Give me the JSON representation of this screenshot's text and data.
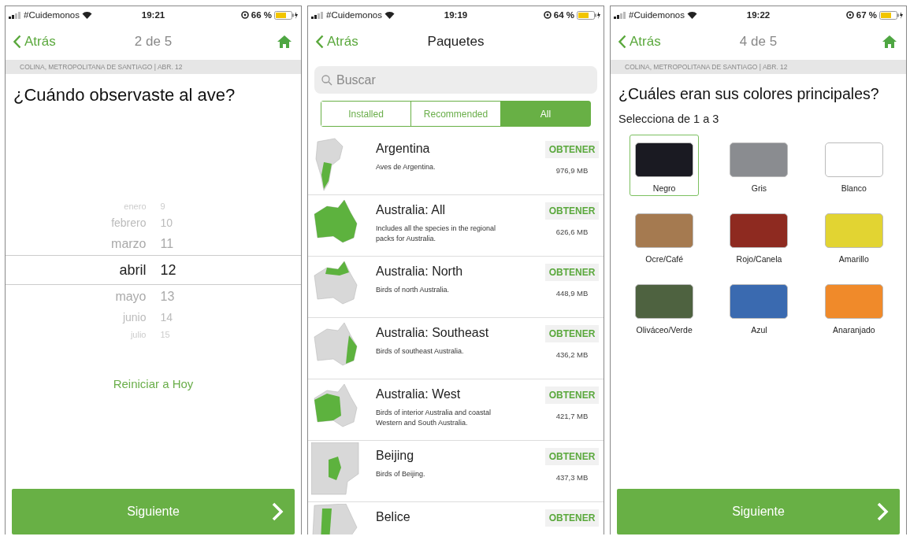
{
  "screens": [
    {
      "kind": "date",
      "status_bar": {
        "carrier": "#Cuidemonos",
        "time": "19:21",
        "battery": "66 %"
      },
      "nav": {
        "back": "Atrás",
        "title": "2 de 5"
      },
      "location": "COLINA, METROPOLITANA DE SANTIAGO | ABR. 12",
      "title": "¿Cuándo observaste al ave?",
      "picker": [
        {
          "month": "enero",
          "day": "9",
          "selected": false
        },
        {
          "month": "febrero",
          "day": "10",
          "selected": false
        },
        {
          "month": "marzo",
          "day": "11",
          "selected": false
        },
        {
          "month": "abril",
          "day": "12",
          "selected": true
        },
        {
          "month": "mayo",
          "day": "13",
          "selected": false
        },
        {
          "month": "junio",
          "day": "14",
          "selected": false
        },
        {
          "month": "julio",
          "day": "15",
          "selected": false
        }
      ],
      "reset_link": "Reiniciar a Hoy",
      "next_button": "Siguiente"
    },
    {
      "kind": "packages",
      "status_bar": {
        "carrier": "#Cuidemonos",
        "time": "19:19",
        "battery": "64 %"
      },
      "nav": {
        "back": "Atrás",
        "title": "Paquetes"
      },
      "search": {
        "placeholder": "Buscar"
      },
      "tabs": [
        {
          "label": "Installed",
          "selected": false
        },
        {
          "label": "Recommended",
          "selected": false
        },
        {
          "label": "All",
          "selected": true
        }
      ],
      "packages": [
        {
          "name": "Argentina",
          "description": "Aves de Argentina.",
          "action": "OBTENER",
          "size": "976,9 MB"
        },
        {
          "name": "Australia: All",
          "description": "Includes all the species in the regional packs for Australia.",
          "action": "OBTENER",
          "size": "626,6 MB"
        },
        {
          "name": "Australia: North",
          "description": "Birds of north Australia.",
          "action": "OBTENER",
          "size": "448,9 MB"
        },
        {
          "name": "Australia: Southeast",
          "description": "Birds of southeast Australia.",
          "action": "OBTENER",
          "size": "436,2 MB"
        },
        {
          "name": "Australia: West",
          "description": "Birds of interior Australia and coastal Western and South Australia.",
          "action": "OBTENER",
          "size": "421,7 MB"
        },
        {
          "name": "Beijing",
          "description": "Birds of Beijing.",
          "action": "OBTENER",
          "size": "437,3 MB"
        },
        {
          "name": "Belice",
          "action": "OBTENER"
        }
      ]
    },
    {
      "kind": "colors",
      "status_bar": {
        "carrier": "#Cuidemonos",
        "time": "19:22",
        "battery": "67 %"
      },
      "nav": {
        "back": "Atrás",
        "title": "4 de 5"
      },
      "location": "COLINA, METROPOLITANA DE SANTIAGO | ABR. 12",
      "title": "¿Cuáles eran sus colores principales?",
      "subtitle": "Selecciona de 1 a 3",
      "colors": [
        {
          "label": "Negro",
          "color": "#1a1a22",
          "selected": true
        },
        {
          "label": "Gris",
          "color": "#8a8c90",
          "selected": false
        },
        {
          "label": "Blanco",
          "color": "#ffffff",
          "selected": false
        },
        {
          "label": "Ocre/Café",
          "color": "#a57a50",
          "selected": false
        },
        {
          "label": "Rojo/Canela",
          "color": "#8e2a20",
          "selected": false
        },
        {
          "label": "Amarillo",
          "color": "#e2d432",
          "selected": false
        },
        {
          "label": "Oliváceo/Verde",
          "color": "#4e6240",
          "selected": false
        },
        {
          "label": "Azul",
          "color": "#3a6ab0",
          "selected": false
        },
        {
          "label": "Anaranjado",
          "color": "#f08a2a",
          "selected": false
        }
      ],
      "next_button": "Siguiente"
    }
  ]
}
